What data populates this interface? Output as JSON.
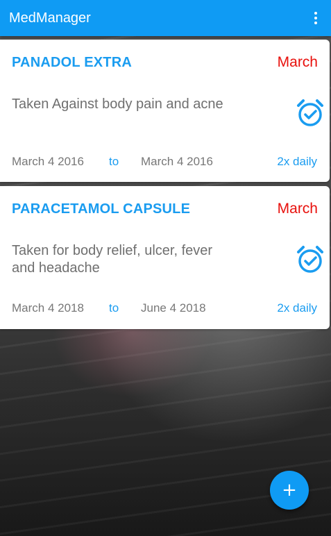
{
  "app": {
    "title": "MedManager",
    "accent_color": "#0f9bf4",
    "month_color": "#e8100c"
  },
  "toolbar": {
    "overflow_icon": "more-vert-icon"
  },
  "medications": [
    {
      "name": "PANADOL EXTRA",
      "month": "March",
      "description": "Taken Against body pain and acne",
      "start_date": "March 4 2016",
      "to_label": "to",
      "end_date": "March 4 2016",
      "frequency": "2x daily",
      "icon": "alarm-check-icon"
    },
    {
      "name": "PARACETAMOL CAPSULE",
      "month": "March",
      "description": "Taken for body relief, ulcer, fever and headache",
      "start_date": "March 4 2018",
      "to_label": "to",
      "end_date": "June 4 2018",
      "frequency": "2x daily",
      "icon": "alarm-check-icon"
    }
  ],
  "fab": {
    "label": "+",
    "icon": "add-icon"
  }
}
